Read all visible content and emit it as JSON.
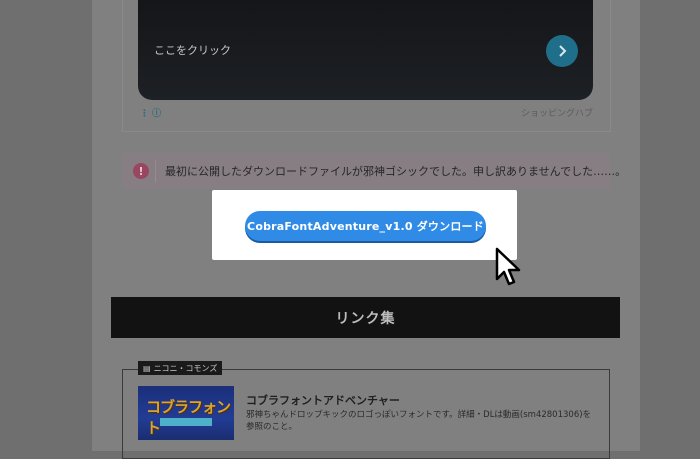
{
  "ad": {
    "cta_text": "ここをクリック",
    "info_label": "ⓘ",
    "brand": "ショッピングハブ",
    "arrow_icon": "chevron-right-icon"
  },
  "notice": {
    "icon": "!",
    "text": "最初に公開したダウンロードファイルが邪神ゴシックでした。申し訳ありませんでした……。"
  },
  "download": {
    "label": "CobraFontAdventure_v1.0 ダウンロード"
  },
  "links": {
    "header": "リンク集",
    "tag": "ニコニ・コモンズ",
    "item": {
      "thumb_title": "コブラフォント",
      "title": "コブラフォントアドベンチャー",
      "description": "邪神ちゃんドロップキックのロゴっぽいフォントです。詳細・DLは動画(sm42801306)を参照のこと。"
    }
  },
  "colors": {
    "button": "#2f8be6",
    "overlay": "#808080",
    "header_bg": "#121212"
  }
}
